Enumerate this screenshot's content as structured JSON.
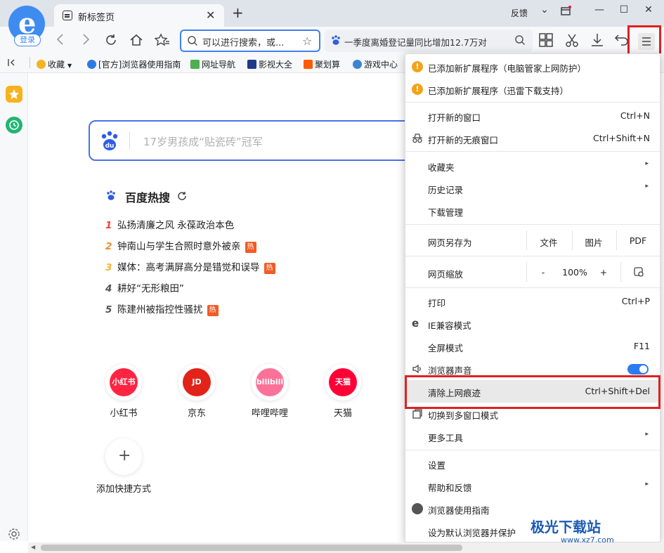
{
  "tab": {
    "title": "新标签页",
    "close": "✕",
    "new": "+"
  },
  "titlebar": {
    "feedback": "反馈",
    "dropdown": "⌄",
    "minimize": "—",
    "maximize": "☐",
    "close": "✕"
  },
  "account": {
    "login_label": "登录"
  },
  "address_bar": {
    "placeholder": "可以进行搜索，或..."
  },
  "search_bar": {
    "text": "一季度离婚登记量同比增加12.7万对"
  },
  "bookmarks": [
    {
      "label": "收藏",
      "icon": "star-icon"
    },
    {
      "label": "[官方]浏览器使用指南",
      "icon": "browser-icon"
    },
    {
      "label": "网址导航",
      "icon": "home-icon"
    },
    {
      "label": "影视大全",
      "icon": "video-icon"
    },
    {
      "label": "聚划算",
      "icon": "deal-icon"
    },
    {
      "label": "游戏中心",
      "icon": "game-icon"
    }
  ],
  "baidu": {
    "placeholder": "17岁男孩成“贴瓷砖”冠军"
  },
  "hot": {
    "title": "百度热搜",
    "tag": "热",
    "items": [
      {
        "num": "1",
        "text": "弘扬清廉之风 永葆政治本色",
        "hot": false,
        "color": "#f04030"
      },
      {
        "num": "2",
        "text": "钟南山与学生合照时意外被亲",
        "hot": true,
        "color": "#f58a2b"
      },
      {
        "num": "3",
        "text": "媒体：高考满屏高分是错觉和误导",
        "hot": true,
        "color": "#f5b52b"
      },
      {
        "num": "4",
        "text": "耕好“无形粮田”",
        "hot": false,
        "color": "#555555"
      },
      {
        "num": "5",
        "text": "陈建州被指控性骚扰",
        "hot": true,
        "color": "#555555"
      }
    ]
  },
  "sites": [
    {
      "label": "小红书",
      "logo": "小红书",
      "color": "#ff2442"
    },
    {
      "label": "京东",
      "logo": "JD",
      "color": "#e2231a"
    },
    {
      "label": "哔哩哔哩",
      "logo": "bilibili",
      "color": "#fb7299"
    },
    {
      "label": "天猫",
      "logo": "天猫",
      "color": "#ff0036"
    }
  ],
  "add_shortcut": {
    "label": "添加快捷方式",
    "icon": "+"
  },
  "menu": {
    "ext1": "已添加新扩展程序（电脑管家上网防护）",
    "ext2": "已添加新扩展程序（迅雷下载支持）",
    "new_window": "打开新的窗口",
    "new_window_sc": "Ctrl+N",
    "incognito": "打开新的无痕窗口",
    "incognito_sc": "Ctrl+Shift+N",
    "favorites": "收藏夹",
    "history": "历史记录",
    "downloads": "下载管理",
    "save_as": "网页另存为",
    "save_file": "文件",
    "save_image": "图片",
    "save_pdf": "PDF",
    "zoom": "网页缩放",
    "zoom_out": "-",
    "zoom_value": "100%",
    "zoom_in": "+",
    "print": "打印",
    "print_sc": "Ctrl+P",
    "ie_mode": "IE兼容模式",
    "fullscreen": "全屏模式",
    "fullscreen_sc": "F11",
    "sound": "浏览器声音",
    "clear": "清除上网痕迹",
    "clear_sc": "Ctrl+Shift+Del",
    "multiwindow": "切换到多窗口模式",
    "more_tools": "更多工具",
    "settings": "设置",
    "help": "帮助和反馈",
    "guide": "浏览器使用指南",
    "default": "设为默认浏览器并保护",
    "arrow": "▸"
  },
  "watermark": {
    "text": "极光下载站",
    "url": "www.xz7.com"
  }
}
